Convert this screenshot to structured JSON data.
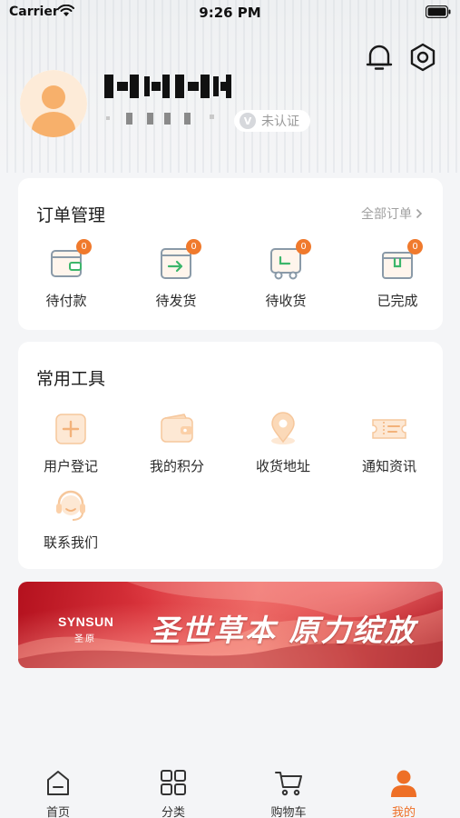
{
  "status_bar": {
    "carrier": "Carrier",
    "time": "9:26 PM"
  },
  "profile": {
    "verify_text": "未认证"
  },
  "orders": {
    "title": "订单管理",
    "all_link": "全部订单",
    "items": [
      {
        "label": "待付款",
        "count": "0",
        "icon": "wallet-icon"
      },
      {
        "label": "待发货",
        "count": "0",
        "icon": "ship-box-icon"
      },
      {
        "label": "待收货",
        "count": "0",
        "icon": "delivery-truck-icon"
      },
      {
        "label": "已完成",
        "count": "0",
        "icon": "completed-box-icon"
      }
    ]
  },
  "tools": {
    "title": "常用工具",
    "items": [
      {
        "label": "用户登记",
        "icon": "register-plus-icon"
      },
      {
        "label": "我的积分",
        "icon": "points-wallet-icon"
      },
      {
        "label": "收货地址",
        "icon": "location-pin-icon"
      },
      {
        "label": "通知资讯",
        "icon": "ticket-icon"
      },
      {
        "label": "联系我们",
        "icon": "headset-icon"
      }
    ]
  },
  "banner": {
    "brand_en": "SYNSUN",
    "brand_cn": "圣原",
    "slogan": "圣世草本 原力绽放"
  },
  "tabs": [
    {
      "label": "首页",
      "icon": "home-icon"
    },
    {
      "label": "分类",
      "icon": "grid-icon"
    },
    {
      "label": "购物车",
      "icon": "cart-icon"
    },
    {
      "label": "我的",
      "icon": "profile-icon",
      "active": true
    }
  ],
  "colors": {
    "accent": "#ee6f26",
    "badge": "#f07a2d",
    "icon_tint": "#f8c79a"
  }
}
